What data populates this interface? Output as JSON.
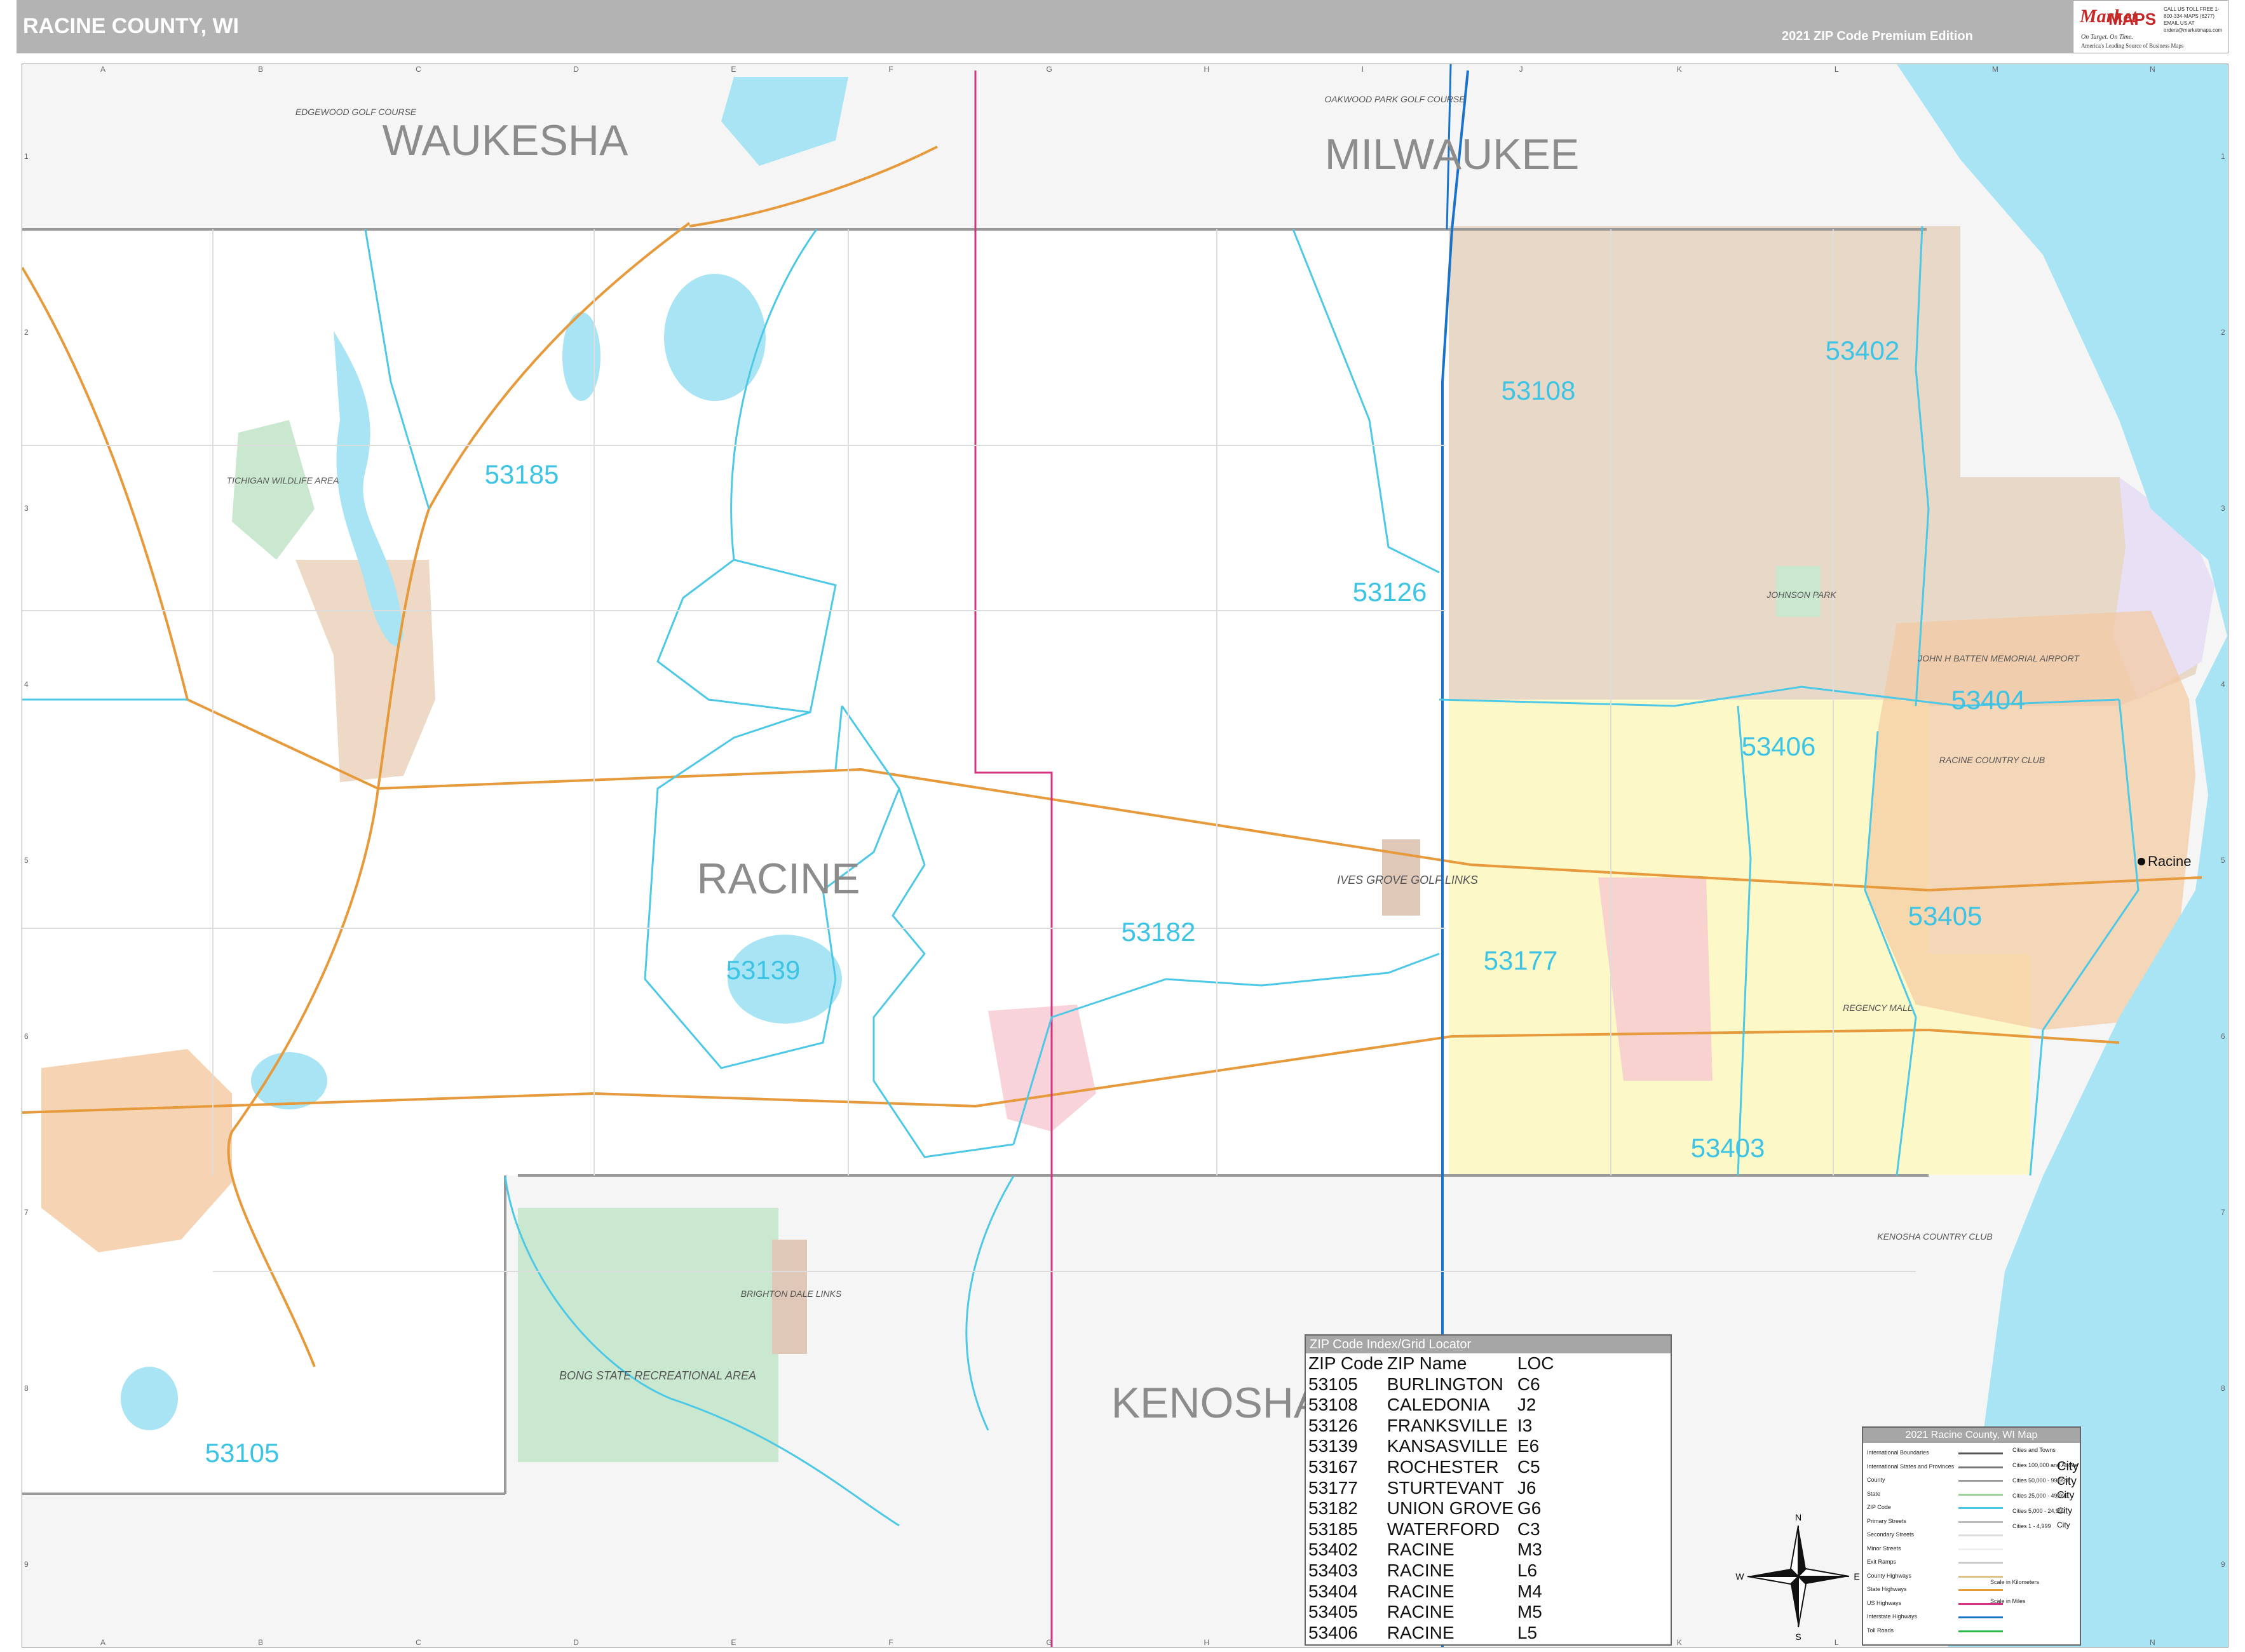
{
  "header": {
    "title": "RACINE COUNTY, WI",
    "edition": "2021 ZIP Code Premium Edition"
  },
  "logo": {
    "brand_mark": "Market",
    "brand_maps": "MAPS",
    "tagline": "On Target.  On Time.",
    "subtagline": "America's Leading Source of Business Maps",
    "contact": "CALL US TOLL FREE 1-800-334-MAPS (6277)  EMAIL US AT orders@marketmaps.com"
  },
  "grid": {
    "columns": [
      "A",
      "B",
      "C",
      "D",
      "E",
      "F",
      "G",
      "H",
      "I",
      "J",
      "K",
      "L",
      "M",
      "N"
    ],
    "rows": [
      "1",
      "2",
      "3",
      "4",
      "5",
      "6",
      "7",
      "8",
      "9"
    ]
  },
  "counties": [
    {
      "name": "WAUKESHA"
    },
    {
      "name": "MILWAUKEE"
    },
    {
      "name": "RACINE"
    },
    {
      "name": "KENOSHA"
    }
  ],
  "cities": [
    {
      "name": "Racine"
    }
  ],
  "zip_labels": [
    {
      "zip": "53185"
    },
    {
      "zip": "53108"
    },
    {
      "zip": "53402"
    },
    {
      "zip": "53126"
    },
    {
      "zip": "53406"
    },
    {
      "zip": "53404"
    },
    {
      "zip": "53182"
    },
    {
      "zip": "53139"
    },
    {
      "zip": "53177"
    },
    {
      "zip": "53405"
    },
    {
      "zip": "53403"
    },
    {
      "zip": "53105"
    }
  ],
  "parks": [
    {
      "name": "TICHIGAN WILDLIFE AREA"
    },
    {
      "name": "BONG STATE RECREATIONAL AREA"
    },
    {
      "name": "IVES GROVE GOLF LINKS"
    },
    {
      "name": "JOHNSON PARK"
    },
    {
      "name": "JOHN H BATTEN MEMORIAL AIRPORT"
    },
    {
      "name": "BRIGHTON DALE LINKS"
    },
    {
      "name": "KENOSHA COUNTRY CLUB"
    },
    {
      "name": "EDGEWOOD GOLF COURSE"
    },
    {
      "name": "OAKWOOD PARK GOLF COURSE"
    },
    {
      "name": "REGENCY MALL"
    },
    {
      "name": "RACINE COUNTRY CLUB"
    }
  ],
  "zip_index": {
    "title": "ZIP Code Index/Grid Locator",
    "headers": [
      "ZIP Code",
      "ZIP Name",
      "LOC"
    ],
    "rows": [
      [
        "53105",
        "BURLINGTON",
        "C6"
      ],
      [
        "53108",
        "CALEDONIA",
        "J2"
      ],
      [
        "53126",
        "FRANKSVILLE",
        "I3"
      ],
      [
        "53139",
        "KANSASVILLE",
        "E6"
      ],
      [
        "53167",
        "ROCHESTER",
        "C5"
      ],
      [
        "53177",
        "STURTEVANT",
        "J6"
      ],
      [
        "53182",
        "UNION GROVE",
        "G6"
      ],
      [
        "53185",
        "WATERFORD",
        "C3"
      ],
      [
        "53402",
        "RACINE",
        "M3"
      ],
      [
        "53403",
        "RACINE",
        "L6"
      ],
      [
        "53404",
        "RACINE",
        "M4"
      ],
      [
        "53405",
        "RACINE",
        "M5"
      ],
      [
        "53406",
        "RACINE",
        "L5"
      ]
    ]
  },
  "legend": {
    "title": "2021 Racine County, WI Map",
    "items": [
      {
        "label": "International Boundaries",
        "color": "#555555"
      },
      {
        "label": "International States and Provinces",
        "color": "#777777"
      },
      {
        "label": "County",
        "color": "#999999"
      },
      {
        "label": "State",
        "color": "#9ad29a"
      },
      {
        "label": "ZIP Code",
        "color": "#4dc8e6"
      },
      {
        "label": "Primary Streets",
        "color": "#bbbbbb"
      },
      {
        "label": "Secondary Streets",
        "color": "#dddddd"
      },
      {
        "label": "Minor Streets",
        "color": "#eeeeee"
      },
      {
        "label": "Exit Ramps",
        "color": "#cccccc"
      },
      {
        "label": "County Highways",
        "color": "#e0c080"
      },
      {
        "label": "State Highways",
        "color": "#e69a3c"
      },
      {
        "label": "US Highways",
        "color": "#d63384"
      },
      {
        "label": "Interstate Highways",
        "color": "#1a73c9"
      },
      {
        "label": "Toll Roads",
        "color": "#2db84a"
      }
    ],
    "city_classes": [
      {
        "label": "Cities and Towns",
        "demo": ""
      },
      {
        "label": "Cities 100,000 and Above",
        "demo": "City"
      },
      {
        "label": "Cities 50,000 - 99,999",
        "demo": "City"
      },
      {
        "label": "Cities 25,000 - 49,999",
        "demo": "City"
      },
      {
        "label": "Cities 5,000 - 24,999",
        "demo": "City"
      },
      {
        "label": "Cities 1 - 4,999",
        "demo": "City"
      }
    ],
    "scale_km": "Scale in Kilometers",
    "scale_mi": "Scale in Miles"
  },
  "compass": {
    "n": "N",
    "s": "S",
    "e": "E",
    "w": "W"
  },
  "colors": {
    "water": "#a8e4f4",
    "zip_line": "#4dc8e6",
    "zip_label": "#3dc4e4",
    "county_label": "#8c8c8c",
    "zone_53108": "#e8d8c8",
    "zone_53406": "#fdf8c8",
    "zone_53404": "#e8e0f4",
    "urban": "#f4c9a0",
    "park": "#c9e8cf"
  }
}
